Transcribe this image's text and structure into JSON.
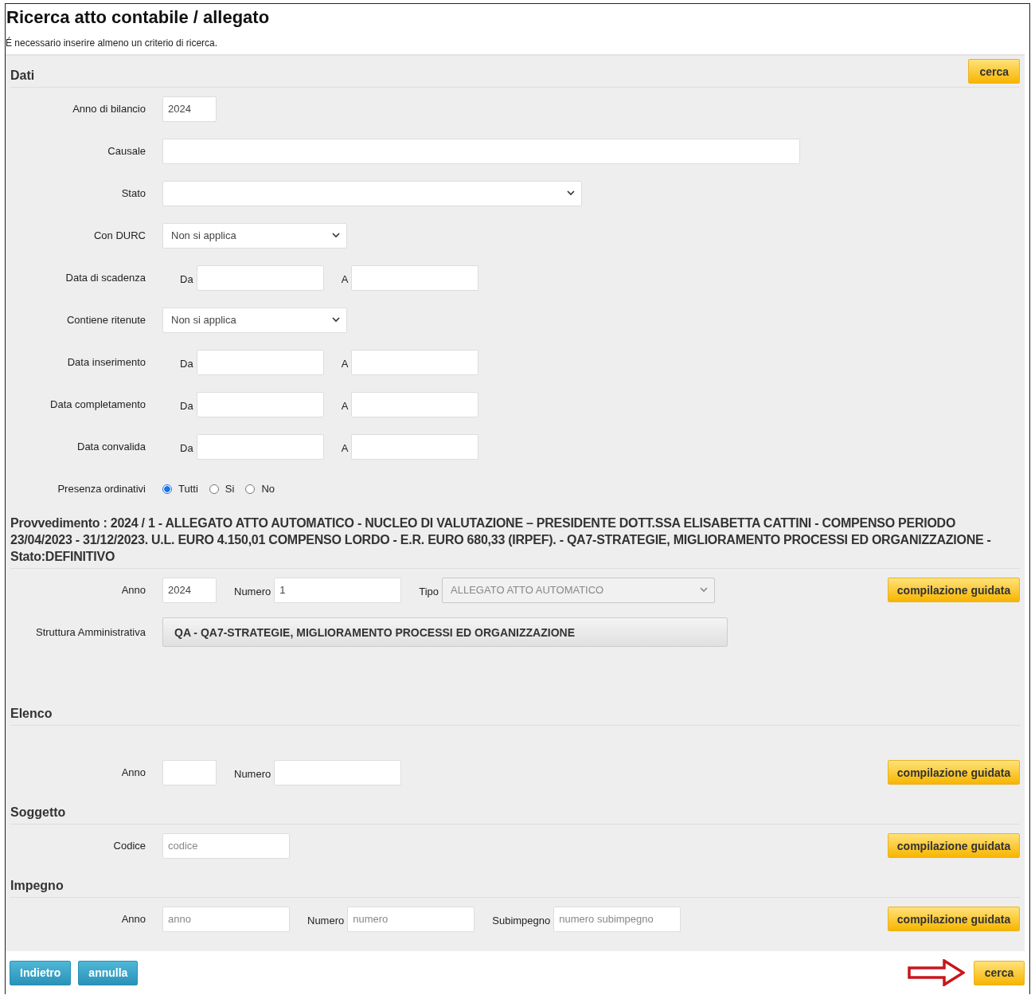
{
  "title": "Ricerca atto contabile / allegato",
  "note": "É necessario inserire almeno un criterio di ricerca.",
  "sections": [
    {
      "title": "Dati",
      "header_button": "cerca",
      "rows": [
        {
          "label": "Anno di bilancio",
          "kind": "fields",
          "fields": [
            {
              "kind": "input_short",
              "value": "2024",
              "disabled": false
            }
          ]
        },
        {
          "label": "Causale",
          "kind": "fields",
          "fields": [
            {
              "kind": "input_long",
              "disabled": false
            }
          ]
        },
        {
          "label": "Stato",
          "kind": "fields",
          "fields": [
            {
              "kind": "select_long",
              "disabled": false
            }
          ]
        },
        {
          "label": "Con DURC",
          "kind": "fields",
          "fields": [
            {
              "kind": "select_short",
              "value": "Non si applica",
              "disabled": false
            }
          ]
        },
        {
          "label": "Data di scadenza",
          "kind": "fields",
          "fields": [
            {
              "kind": "input",
              "label": "Da",
              "disabled": false
            },
            {
              "kind": "input",
              "label": "A",
              "disabled": false
            }
          ]
        },
        {
          "label": "Contiene ritenute",
          "kind": "fields",
          "fields": [
            {
              "kind": "select_short",
              "value": "Non si applica",
              "disabled": false
            }
          ]
        },
        {
          "label": "Data inserimento",
          "kind": "fields",
          "fields": [
            {
              "kind": "input",
              "label": "Da",
              "disabled": false
            },
            {
              "kind": "input",
              "label": "A",
              "disabled": false
            }
          ]
        },
        {
          "label": "Data completamento",
          "kind": "fields",
          "fields": [
            {
              "kind": "input",
              "label": "Da",
              "disabled": false
            },
            {
              "kind": "input",
              "label": "A",
              "disabled": false
            }
          ]
        },
        {
          "label": "Data convalida",
          "kind": "fields",
          "fields": [
            {
              "kind": "input",
              "label": "Da",
              "disabled": false
            },
            {
              "kind": "input",
              "label": "A",
              "disabled": false
            }
          ]
        },
        {
          "label": "Presenza ordinativi",
          "kind": "radio",
          "options": [
            {
              "label": "Tutti",
              "selected": true
            },
            {
              "label": "Si",
              "selected": false
            },
            {
              "label": "No",
              "selected": false
            }
          ]
        }
      ]
    },
    {
      "title": "Provvedimento : 2024 / 1 - ALLEGATO ATTO AUTOMATICO - NUCLEO DI VALUTAZIONE – PRESIDENTE DOTT.SSA ELISABETTA CATTINI - COMPENSO PERIODO 23/04/2023 - 31/12/2023. U.L. EURO 4.150,01 COMPENSO LORDO - E.R. EURO 680,33 (IRPEF). - QA7-STRATEGIE, MIGLIORAMENTO PROCESSI ED ORGANIZZAZIONE - Stato:DEFINITIVO",
      "rows": [
        {
          "label": "Anno",
          "kind": "fields",
          "button": "compilazione guidata",
          "fields": [
            {
              "kind": "input_short",
              "value": "2024",
              "disabled": false
            },
            {
              "kind": "input",
              "label": "Numero",
              "value": "1",
              "disabled": false
            },
            {
              "kind": "select_medium",
              "label": "Tipo",
              "value": "ALLEGATO ATTO AUTOMATICO",
              "disabled": true
            }
          ]
        },
        {
          "label": "Struttura Amministrativa",
          "kind": "fields",
          "fields": [
            {
              "kind": "readonly",
              "value": "QA - QA7-STRATEGIE, MIGLIORAMENTO PROCESSI ED ORGANIZZAZIONE",
              "disabled": false
            }
          ]
        }
      ]
    },
    {
      "title": "Elenco",
      "rows": [
        {
          "label": "Anno",
          "kind": "fields",
          "button": "compilazione guidata",
          "fields": [
            {
              "kind": "input_short",
              "disabled": false
            },
            {
              "kind": "input",
              "label": "Numero",
              "disabled": false
            }
          ]
        }
      ]
    },
    {
      "title": "Soggetto",
      "rows": [
        {
          "label": "Codice",
          "kind": "fields",
          "button": "compilazione guidata",
          "fields": [
            {
              "kind": "input",
              "placeholder": "codice",
              "disabled": false
            }
          ]
        }
      ]
    },
    {
      "title": "Impegno",
      "rows": [
        {
          "label": "Anno",
          "kind": "fields",
          "button": "compilazione guidata",
          "fields": [
            {
              "kind": "input",
              "placeholder": "anno",
              "disabled": false
            },
            {
              "kind": "input",
              "label": "Numero",
              "placeholder": "numero",
              "disabled": false
            },
            {
              "kind": "input",
              "label": "Subimpegno",
              "placeholder": "numero subimpegno",
              "disabled": false
            }
          ]
        }
      ]
    }
  ],
  "footer": {
    "buttons": [
      {
        "label": "Indietro",
        "kind": "secondary"
      },
      {
        "label": "annulla",
        "kind": "secondary"
      }
    ],
    "search": "cerca"
  }
}
